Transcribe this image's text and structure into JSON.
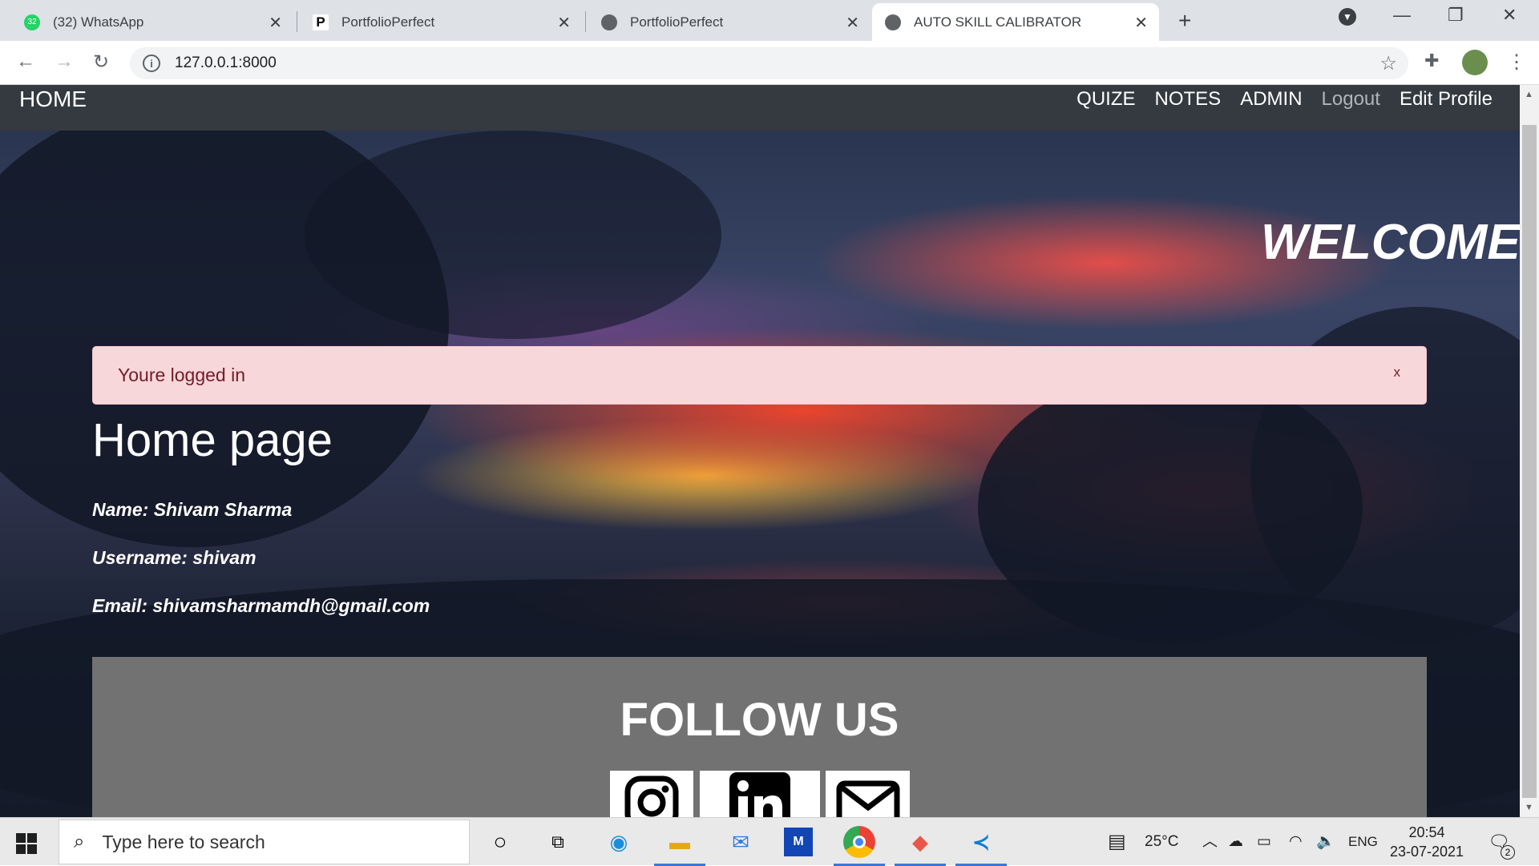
{
  "browser": {
    "tabs": [
      {
        "title": "(32) WhatsApp",
        "badge": "32"
      },
      {
        "title": "PortfolioPerfect"
      },
      {
        "title": "PortfolioPerfect"
      },
      {
        "title": "AUTO SKILL CALIBRATOR"
      }
    ],
    "url": "127.0.0.1:8000"
  },
  "navbar": {
    "brand": "HOME",
    "links": [
      "QUIZE",
      "NOTES",
      "ADMIN",
      "Logout",
      "Edit Profile"
    ]
  },
  "hero": {
    "welcome": "WELCOME T",
    "alert": {
      "message": "Youre logged in",
      "close": "x"
    },
    "title": "Home page",
    "name_line": "Name: Shivam Sharma",
    "username_line": "Username: shivam",
    "email_line": "Email: shivamsharmamdh@gmail.com"
  },
  "follow": {
    "title": "FOLLOW US",
    "icons": [
      "instagram-icon",
      "linkedin-icon",
      "mail-icon"
    ]
  },
  "taskbar": {
    "search_placeholder": "Type here to search",
    "weather": "25°C",
    "language": "ENG",
    "time": "20:54",
    "date": "23-07-2021",
    "notifications": "2"
  }
}
